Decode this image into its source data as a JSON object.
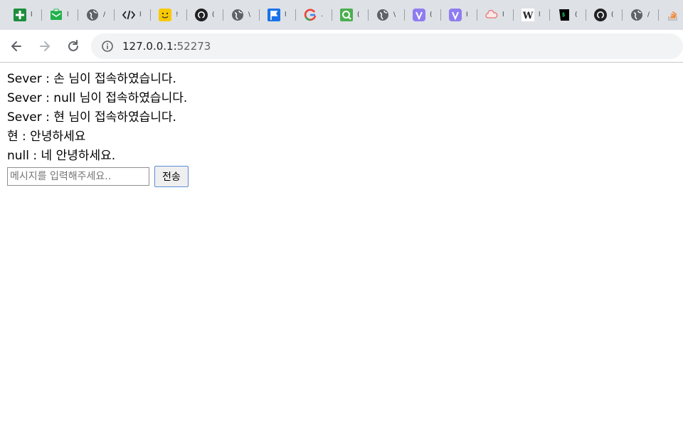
{
  "browser": {
    "tabs": [
      {
        "icon": "google-sheets-icon",
        "color": "#1e8e3e",
        "text": "l"
      },
      {
        "icon": "mail-icon",
        "color": "#22b14c",
        "text": "l"
      },
      {
        "icon": "globe-icon",
        "color": "#5f6368",
        "text": "/"
      },
      {
        "icon": "code-icon",
        "color": "#202124",
        "text": "l"
      },
      {
        "icon": "smiley-icon",
        "color": "#f9c900",
        "text": "!"
      },
      {
        "icon": "github-icon",
        "color": "#202124",
        "text": "("
      },
      {
        "icon": "globe-icon",
        "color": "#5f6368",
        "text": "\\"
      },
      {
        "icon": "flag-icon",
        "color": "#1a73e8",
        "text": "l"
      },
      {
        "icon": "google-icon",
        "color": "#4285f4",
        "text": "."
      },
      {
        "icon": "qualcomm-icon",
        "color": "#4caf50",
        "text": "("
      },
      {
        "icon": "globe-icon",
        "color": "#5f6368",
        "text": "\\"
      },
      {
        "icon": "v-icon",
        "color": "#8e7cf0",
        "text": "("
      },
      {
        "icon": "v-icon",
        "color": "#8e7cf0",
        "text": "I"
      },
      {
        "icon": "cloud-icon",
        "color": "#e57373",
        "text": "l"
      },
      {
        "icon": "wikipedia-icon",
        "color": "#202124",
        "text": "l"
      },
      {
        "icon": "terminal-icon",
        "color": "#000000",
        "text": "("
      },
      {
        "icon": "github-icon",
        "color": "#202124",
        "text": "("
      },
      {
        "icon": "globe-icon",
        "color": "#5f6368",
        "text": "/"
      },
      {
        "icon": "stackoverflow-icon",
        "color": "#f48024",
        "text": ""
      }
    ],
    "url_host": "127.0.0.1:",
    "url_port": "52273"
  },
  "chat": {
    "messages": [
      "Sever : 손 님이 접속하였습니다.",
      "Sever : null 님이 접속하였습니다.",
      "Sever : 현 님이 접속하였습니다.",
      "현 : 안녕하세요",
      "null : 네 안녕하세요."
    ],
    "input_placeholder": "메시지를 입력해주세요..",
    "input_value": "",
    "send_label": "전송"
  }
}
